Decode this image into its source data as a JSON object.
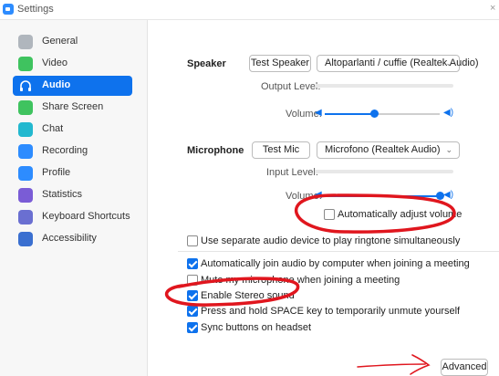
{
  "window": {
    "title": "Settings",
    "close": "×"
  },
  "sidebar": {
    "items": [
      {
        "label": "General",
        "icon": "gear-icon",
        "color": "#b0b6bd"
      },
      {
        "label": "Video",
        "icon": "video-icon",
        "color": "#3fc35f"
      },
      {
        "label": "Audio",
        "icon": "headphones-icon",
        "color": "#0e72ed",
        "active": true
      },
      {
        "label": "Share Screen",
        "icon": "share-screen-icon",
        "color": "#3fc35f"
      },
      {
        "label": "Chat",
        "icon": "chat-icon",
        "color": "#22b8cf"
      },
      {
        "label": "Recording",
        "icon": "recording-icon",
        "color": "#2d8cff"
      },
      {
        "label": "Profile",
        "icon": "profile-icon",
        "color": "#2d8cff"
      },
      {
        "label": "Statistics",
        "icon": "statistics-icon",
        "color": "#7a5cd6"
      },
      {
        "label": "Keyboard Shortcuts",
        "icon": "keyboard-icon",
        "color": "#6a6fd1"
      },
      {
        "label": "Accessibility",
        "icon": "accessibility-icon",
        "color": "#3a6fd0"
      }
    ]
  },
  "speaker": {
    "label": "Speaker",
    "test_button": "Test Speaker",
    "device": "Altoparlanti / cuffie (Realtek Audio)",
    "output_level_label": "Output Level:",
    "volume_label": "Volume:",
    "volume": 0.43
  },
  "microphone": {
    "label": "Microphone",
    "test_button": "Test Mic",
    "device": "Microfono (Realtek Audio)",
    "input_level_label": "Input Level:",
    "volume_label": "Volume:",
    "volume": 1.0,
    "auto_adjust_label": "Automatically adjust volume",
    "auto_adjust": false
  },
  "options": {
    "separate_device": {
      "label": "Use separate audio device to play ringtone simultaneously",
      "checked": false
    },
    "auto_join": {
      "label": "Automatically join audio by computer when joining a meeting",
      "checked": true
    },
    "mute_mic": {
      "label": "Mute my microphone when joining a meeting",
      "checked": false
    },
    "stereo": {
      "label": "Enable Stereo sound",
      "checked": true
    },
    "space_unmute": {
      "label": "Press and hold SPACE key to temporarily unmute yourself",
      "checked": true
    },
    "sync_headset": {
      "label": "Sync buttons on headset",
      "checked": true
    }
  },
  "advanced_button": "Advanced",
  "colors": {
    "accent": "#0e72ed",
    "annotation": "#e0161e"
  }
}
